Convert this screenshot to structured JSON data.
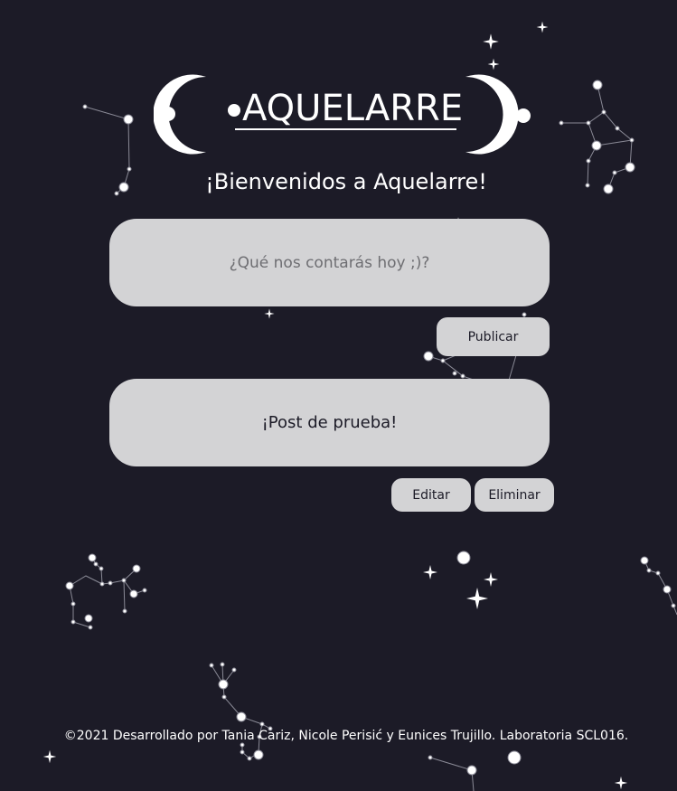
{
  "header": {
    "logo_text": "AQUELARRE",
    "welcome": "¡Bienvenidos a Aquelarre!"
  },
  "composer": {
    "placeholder": "¿Qué nos contarás hoy ;)?",
    "value": "",
    "publish_label": "Publicar"
  },
  "posts": [
    {
      "text": "¡Post de prueba!",
      "edit_label": "Editar",
      "delete_label": "Eliminar"
    }
  ],
  "footer": {
    "text": "©2021 Desarrollado por Tania Cariz, Nicole Perisić y Eunices Trujillo. Laboratoria SCL016."
  },
  "colors": {
    "background": "#1c1b27",
    "surface": "#d3d3d5",
    "text_light": "#ffffff",
    "text_dark": "#1c1b27",
    "placeholder": "#6e6e72"
  },
  "icons": [
    "moon-icon",
    "star-icon",
    "constellation-icon"
  ]
}
